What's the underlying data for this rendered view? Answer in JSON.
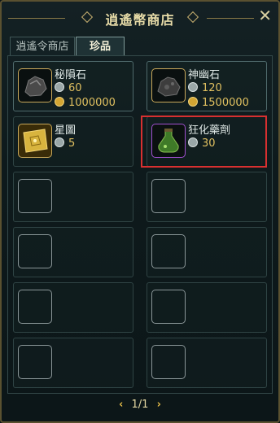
{
  "window": {
    "title": "逍遙幣商店",
    "close_glyph": "✕"
  },
  "tabs": [
    {
      "label": "逍遙令商店"
    },
    {
      "label": "珍品"
    }
  ],
  "items": [
    {
      "name": "秘隕石",
      "quantity": "60",
      "price": "1000000",
      "icon": "meteorite-icon"
    },
    {
      "name": "神幽石",
      "quantity": "120",
      "price": "1500000",
      "icon": "dark-stone-icon"
    },
    {
      "name": "星圖",
      "quantity": "5",
      "icon": "star-map-icon"
    },
    {
      "name": "狂化藥劑",
      "quantity": "30",
      "icon": "potion-icon"
    }
  ],
  "pager": {
    "prev": "‹",
    "page": "1/1",
    "next": "›"
  }
}
